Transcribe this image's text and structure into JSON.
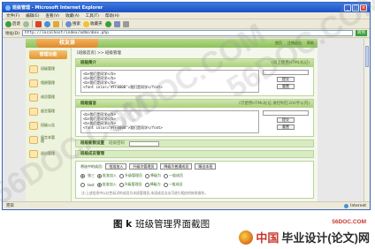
{
  "window": {
    "title": "班级管理 - Microsoft Internet Explorer",
    "menu": [
      "文件(F)",
      "编辑(E)",
      "查看(V)",
      "收藏(A)",
      "工具(T)",
      "帮助(H)"
    ],
    "toolbar": [
      "后退",
      "搜索",
      "收藏夹"
    ],
    "address_label": "地址(D)",
    "address_value": "http://localhost/index/adminbox.php",
    "go_label": "转到",
    "status_text": "完毕",
    "status_zone": "Internet"
  },
  "site": {
    "logo": "校友录",
    "top_links": [
      "首页",
      "注销退出",
      "帮助"
    ]
  },
  "sidebar": {
    "heading": "管理功能",
    "items": [
      {
        "label": "班级管理"
      },
      {
        "label": "相册管理"
      },
      {
        "label": "成员管理"
      },
      {
        "label": "留言管理"
      },
      {
        "label": "班级公告"
      },
      {
        "label": "留言本管理"
      },
      {
        "label": "退出管理"
      }
    ]
  },
  "main": {
    "breadcrumb": "[班级首页] >> 班级管理",
    "class_intro": {
      "title": "班级简介",
      "note": "(同上使用HTML标记)",
      "lines": [
        "<b>我们是同学</b>",
        "<b>我们是同学</b>",
        "<b>我们是同学</b>",
        "<font color=\"#FF0000\">我们是同学</font>"
      ],
      "buttons": [
        "提交",
        "重置"
      ]
    },
    "class_notice": {
      "title": "班级留言",
      "note": "(可使用HTML标记,请控制在200字以内)",
      "lines": [
        "<b>我们是同学</b>",
        "<b>我们是同学</b>",
        "<b>我们是同学</b>",
        "<font color=\"#FF0000\">我们是同学</font>"
      ],
      "buttons": [
        "提交",
        "重置"
      ]
    },
    "password_bar": {
      "title": "班级新数设置",
      "hint": "班级密码"
    },
    "member_bar": {
      "title": "班级成员管理"
    },
    "member_row1": {
      "label": "将选中的成员:",
      "buttons": [
        "批准加入",
        "升级为管理员",
        "降级为普通成员",
        "踢出本班"
      ]
    },
    "member_row2": {
      "name": "张三",
      "options": [
        "批准加入",
        "升级管理员",
        "降级为",
        "一般成员"
      ]
    },
    "member_row3": {
      "name": "test",
      "options": [
        "批准加入",
        "升级管理员",
        "降级为",
        "一般成员"
      ]
    },
    "footnote": "注:上述信息中以红色标识的成员为本班管理员,本班成员点击可进行相应的修改操作。"
  },
  "caption": {
    "fig": "图 k",
    "text": "班级管理界面截图"
  },
  "branding": {
    "top": "56DOC.COM",
    "cn1": "中国",
    "cn2": "毕业设计(论文)网"
  },
  "watermark": "56DOC.COM"
}
